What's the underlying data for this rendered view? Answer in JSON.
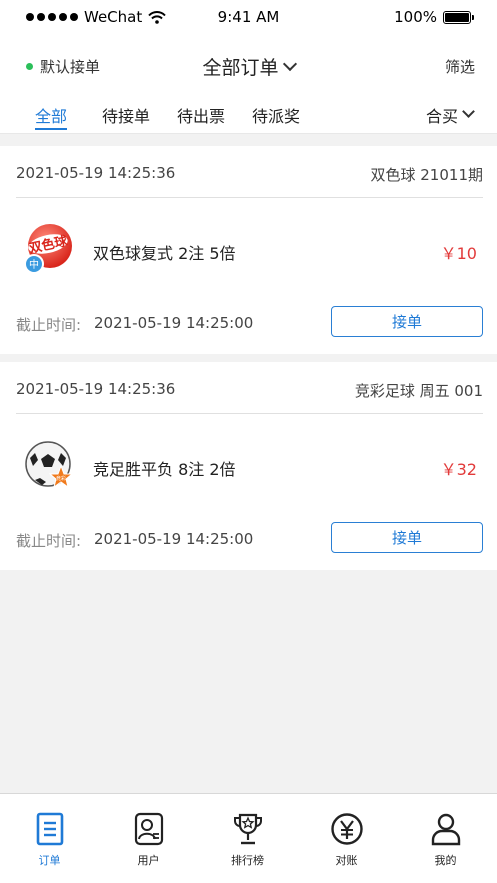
{
  "status_bar": {
    "carrier": "WeChat",
    "time": "9:41 AM",
    "battery": "100%"
  },
  "nav": {
    "accept_default": "默认接单",
    "title": "全部订单",
    "filter": "筛选"
  },
  "tabs": {
    "items": [
      "全部",
      "待接单",
      "待出票",
      "待派奖"
    ],
    "active": "全部",
    "combo": "合买"
  },
  "orders": [
    {
      "time": "2021-05-19 14:25:36",
      "issue": "双色球 21011期",
      "logo": "double-color-ball-logo",
      "desc": "双色球复式 2注 5倍",
      "amount": "￥10",
      "deadline_label": "截止时间:",
      "deadline": "2021-05-19 14:25:00",
      "action": "接单"
    },
    {
      "time": "2021-05-19 14:25:36",
      "issue": "竞彩足球 周五 001",
      "logo": "football-lottery-logo",
      "desc": "竞足胜平负 8注 2倍",
      "amount": "￥32",
      "deadline_label": "截止时间:",
      "deadline": "2021-05-19 14:25:00",
      "action": "接单"
    }
  ],
  "tabbar": {
    "items": [
      {
        "label": "订单",
        "icon": "order-icon"
      },
      {
        "label": "用户",
        "icon": "user-card-icon"
      },
      {
        "label": "排行榜",
        "icon": "trophy-icon"
      },
      {
        "label": "对账",
        "icon": "yuan-icon"
      },
      {
        "label": "我的",
        "icon": "profile-icon"
      }
    ],
    "active": "订单"
  },
  "colors": {
    "accent": "#1f7ad6",
    "amount": "#e23b3b",
    "online": "#2bbf5a"
  }
}
